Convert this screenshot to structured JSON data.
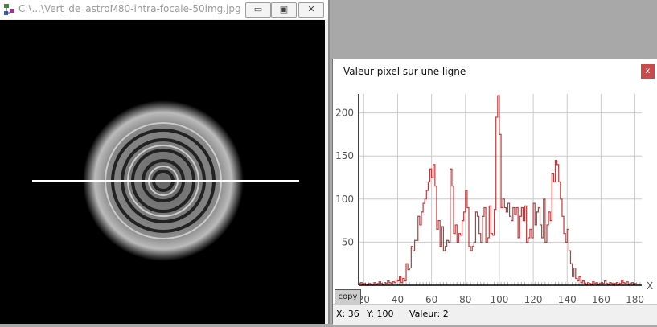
{
  "image_window": {
    "title": "C:\\...\\Vert_de_astroM80-intra-focale-50img.jpg",
    "minimize": "▭",
    "maximize": "▣",
    "close": "✕"
  },
  "dialog": {
    "title": "Valeur pixel sur une ligne",
    "close": "x",
    "copy_label": "copy",
    "status": {
      "x": "X: 36",
      "y": "Y: 100",
      "value": "Valeur: 2"
    }
  },
  "colors": {
    "series": "#c0393b",
    "close_bg": "#c84a4a"
  },
  "chart_data": {
    "type": "line",
    "step": true,
    "title": "",
    "xlabel": "X",
    "ylabel": "",
    "xlim": [
      17,
      184
    ],
    "ylim": [
      0,
      222
    ],
    "xticks": [
      20,
      40,
      60,
      80,
      100,
      120,
      140,
      160,
      180
    ],
    "yticks": [
      50,
      100,
      150,
      200
    ],
    "x_start": 17,
    "values": [
      2,
      3,
      1,
      2,
      0,
      1,
      2,
      1,
      0,
      3,
      1,
      2,
      4,
      2,
      1,
      3,
      2,
      5,
      3,
      2,
      4,
      3,
      6,
      5,
      10,
      3,
      8,
      5,
      25,
      18,
      20,
      45,
      40,
      52,
      52,
      80,
      70,
      85,
      95,
      100,
      110,
      120,
      135,
      125,
      140,
      115,
      65,
      75,
      45,
      68,
      40,
      45,
      52,
      50,
      135,
      115,
      60,
      70,
      50,
      60,
      58,
      75,
      85,
      110,
      90,
      45,
      40,
      45,
      50,
      85,
      80,
      60,
      50,
      80,
      90,
      50,
      55,
      92,
      60,
      58,
      88,
      195,
      220,
      175,
      90,
      100,
      90,
      85,
      95,
      80,
      75,
      90,
      82,
      90,
      55,
      80,
      90,
      75,
      92,
      50,
      55,
      65,
      55,
      95,
      70,
      85,
      90,
      70,
      55,
      100,
      50,
      70,
      85,
      75,
      130,
      120,
      145,
      140,
      120,
      100,
      80,
      60,
      50,
      65,
      40,
      25,
      10,
      20,
      8,
      5,
      10,
      3,
      5,
      2,
      1,
      3,
      2,
      1,
      4,
      2,
      3,
      1,
      2,
      3,
      2,
      5,
      2,
      1,
      3,
      2,
      0,
      2,
      3,
      1,
      2,
      6,
      3,
      2,
      4,
      1,
      2,
      3,
      1,
      2
    ]
  }
}
